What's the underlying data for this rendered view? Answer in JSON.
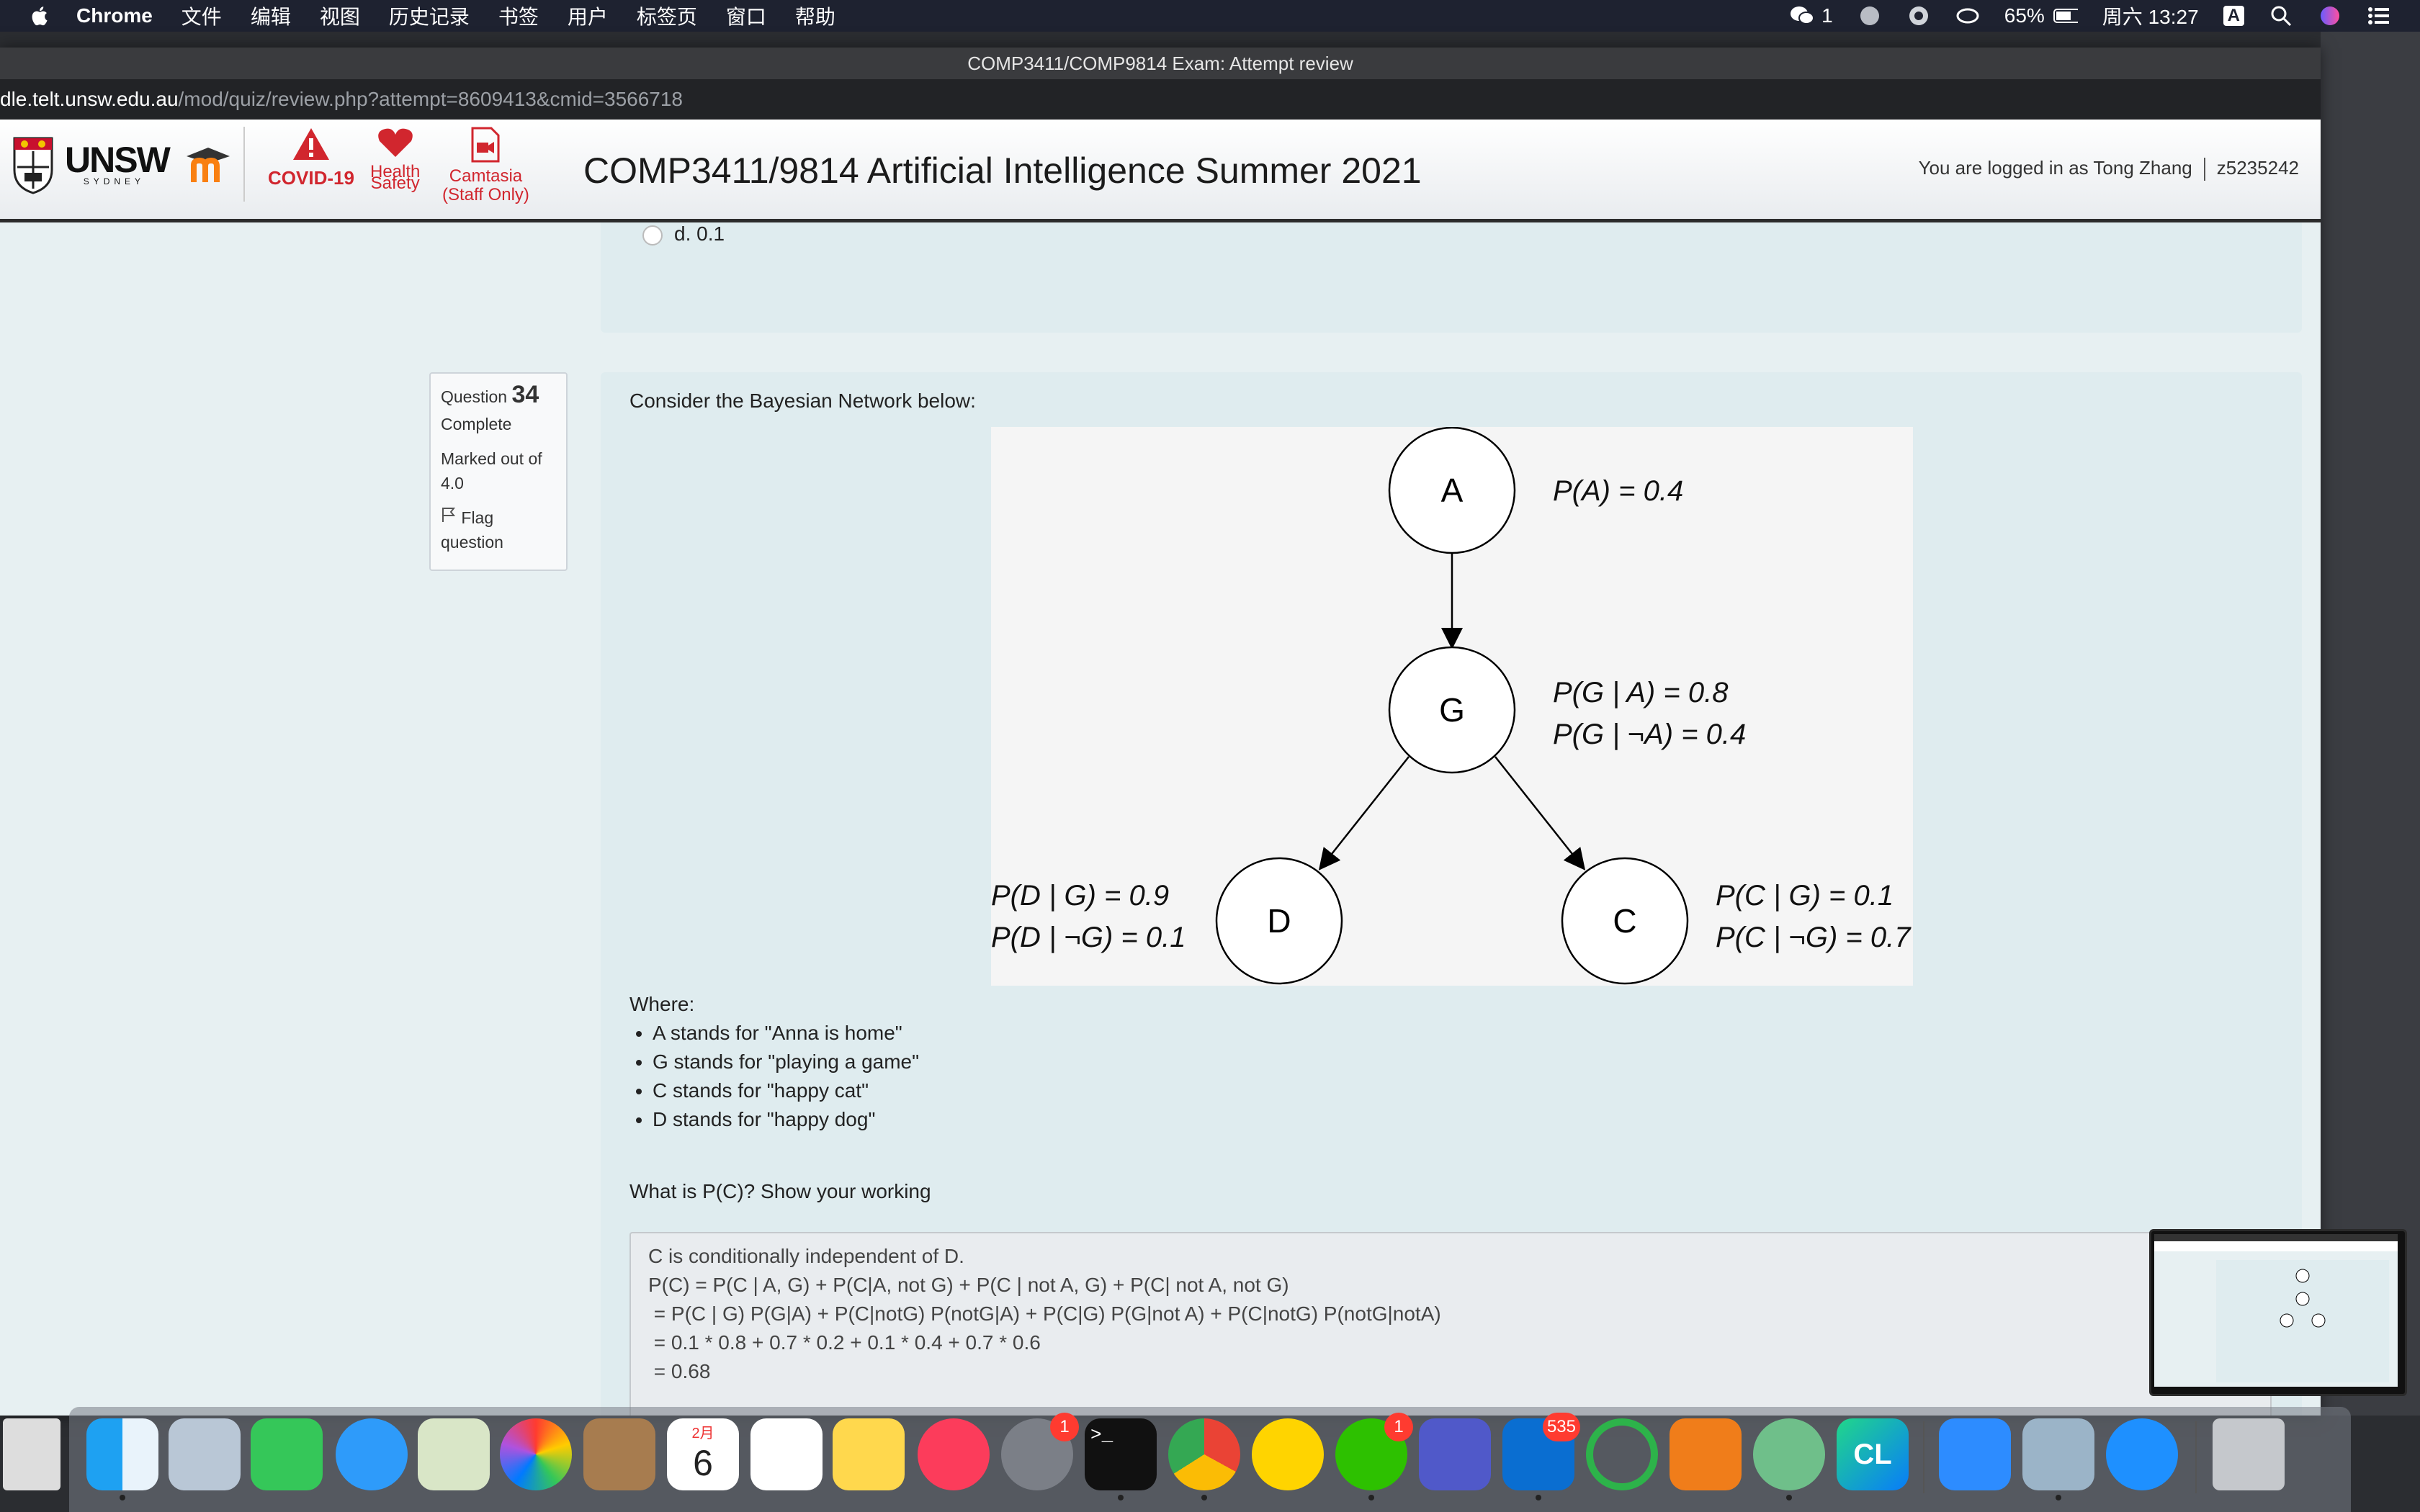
{
  "menubar": {
    "app": "Chrome",
    "items": [
      "文件",
      "编辑",
      "视图",
      "历史记录",
      "书签",
      "用户",
      "标签页",
      "窗口",
      "帮助"
    ],
    "wechat_count": "1",
    "battery": "65%",
    "clock": "周六 13:27",
    "input_method": "A"
  },
  "window": {
    "title": "COMP3411/COMP9814 Exam: Attempt review",
    "url_host": "dle.telt.unsw.edu.au",
    "url_path": "/mod/quiz/review.php?attempt=8609413&cmid=3566718"
  },
  "header": {
    "logo_text": "UNSW",
    "logo_sub": "SYDNEY",
    "covid_label": "COVID-19",
    "health_label_1": "Health",
    "health_label_2": "Safety",
    "camtasia_label_1": "Camtasia",
    "camtasia_label_2": "(Staff Only)",
    "course_title": "COMP3411/9814 Artificial Intelligence Summer 2021",
    "logged_in_text": "You are logged in as Tong Zhang",
    "user_id": "z5235242"
  },
  "prev_question": {
    "option_d": "d. 0.1"
  },
  "question": {
    "label": "Question",
    "number": "34",
    "state": "Complete",
    "marked_label": "Marked out of",
    "marked_value": "4.0",
    "flag_label_1": "Flag",
    "flag_label_2": "question",
    "intro": "Consider the Bayesian Network below:",
    "diagram": {
      "node_a": "A",
      "node_g": "G",
      "node_d": "D",
      "node_c": "C",
      "p_a": "P(A) = 0.4",
      "p_g_a": "P(G | A) = 0.8",
      "p_g_nota": "P(G | ¬A) = 0.4",
      "p_d_g": "P(D | G) = 0.9",
      "p_d_notg": "P(D | ¬G) = 0.1",
      "p_c_g": "P(C | G) = 0.1",
      "p_c_notg": "P(C | ¬G) = 0.7"
    },
    "where_label": "Where:",
    "definitions": [
      "A stands for \"Anna is home\"",
      "G stands for \"playing a game\"",
      "C stands for \"happy cat\"",
      "D stands for \"happy dog\""
    ],
    "prompt": "What is P(C)? Show your working",
    "answer_lines": [
      "C is conditionally independent of D.",
      "P(C) = P(C | A, G) + P(C|A, not G) + P(C | not A, G) + P(C| not A, not G)",
      " = P(C | G) P(G|A) + P(C|notG) P(notG|A) + P(C|G) P(G|not A) + P(C|notG) P(notG|notA)",
      " = 0.1 * 0.8 + 0.7 * 0.2 + 0.1 * 0.4 + 0.7 * 0.6",
      " = 0.68"
    ]
  },
  "dock": {
    "calendar_month": "2月",
    "calendar_day": "6",
    "sysprefs_badge": "1",
    "wechat_badge": "1",
    "outlook_badge": "535"
  }
}
